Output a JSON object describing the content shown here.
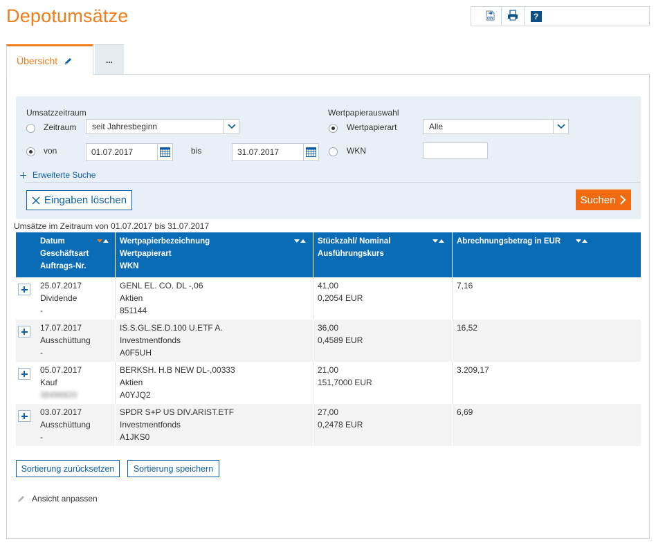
{
  "page_title": "Depotumsätze",
  "toolbar": {
    "csv_icon": "csv-export-icon",
    "print_icon": "print-icon",
    "help_label": "?"
  },
  "tabs": [
    {
      "label": "Übersicht",
      "active": true,
      "icon": "pencil-icon"
    },
    {
      "label": "...",
      "active": false
    }
  ],
  "filter": {
    "umsatzzeitraum_label": "Umsatzzeitraum",
    "zeitraum_label": "Zeitraum",
    "zeitraum_value": "seit Jahresbeginn",
    "zeitraum_selected": false,
    "von_label": "von",
    "von_value": "01.07.2017",
    "von_selected": true,
    "bis_label": "bis",
    "bis_value": "31.07.2017",
    "wertpapierauswahl_label": "Wertpapierauswahl",
    "wertpapierart_label": "Wertpapierart",
    "wertpapierart_value": "Alle",
    "wertpapierart_selected": true,
    "wkn_label": "WKN",
    "wkn_value": "",
    "wkn_selected": false,
    "advanced_search": "Erweiterte Suche",
    "clear_button": "Eingaben löschen",
    "search_button": "Suchen"
  },
  "range_caption": "Umsätze im Zeitraum von 01.07.2017 bis 31.07.2017",
  "table": {
    "headers": [
      {
        "lines": [
          "Datum",
          "Geschäftsart",
          "Auftrags-Nr."
        ],
        "sort_active": true
      },
      {
        "lines": [
          "Wertpapierbezeichnung",
          "Wertpapierart",
          "WKN"
        ],
        "sort_active": false
      },
      {
        "lines": [
          "Stückzahl/ Nominal",
          "Ausführungskurs"
        ],
        "sort_active": false
      },
      {
        "lines": [
          "Abrechnungsbetrag in EUR"
        ],
        "sort_active": false
      }
    ],
    "rows": [
      {
        "datum": "25.07.2017",
        "geschaeftsart": "Dividende",
        "auftrag": "-",
        "auftrag_blurred": false,
        "bezeichnung": "GENL EL. CO. DL -,06",
        "art": "Aktien",
        "wkn": "851144",
        "stueck": "41,00",
        "kurs": "0,2054 EUR",
        "betrag": "7,16"
      },
      {
        "datum": "17.07.2017",
        "geschaeftsart": "Ausschüttung",
        "auftrag": "-",
        "auftrag_blurred": false,
        "bezeichnung": "IS.S.GL.SE.D.100 U.ETF A.",
        "art": "Investmentfonds",
        "wkn": "A0F5UH",
        "stueck": "36,00",
        "kurs": "0,4589 EUR",
        "betrag": "16,52"
      },
      {
        "datum": "05.07.2017",
        "geschaeftsart": "Kauf",
        "auftrag": "38496820",
        "auftrag_blurred": true,
        "bezeichnung": "BERKSH. H.B NEW DL-,00333",
        "art": "Aktien",
        "wkn": "A0YJQ2",
        "stueck": "21,00",
        "kurs": "151,7000 EUR",
        "betrag": "3.209,17"
      },
      {
        "datum": "03.07.2017",
        "geschaeftsart": "Ausschüttung",
        "auftrag": "-",
        "auftrag_blurred": false,
        "bezeichnung": "SPDR S+P US DIV.ARIST.ETF",
        "art": "Investmentfonds",
        "wkn": "A1JKS0",
        "stueck": "27,00",
        "kurs": "0,2478 EUR",
        "betrag": "6,69"
      }
    ]
  },
  "buttons": {
    "reset_sort": "Sortierung zurücksetzen",
    "save_sort": "Sortierung speichern"
  },
  "customize_view": "Ansicht anpassen",
  "colors": {
    "brand_orange": "#f07c1b",
    "search_orange": "#f26a10",
    "header_blue": "#0a6bb6",
    "link_blue": "#0a5ea8",
    "filter_bg": "#e8eff6"
  }
}
